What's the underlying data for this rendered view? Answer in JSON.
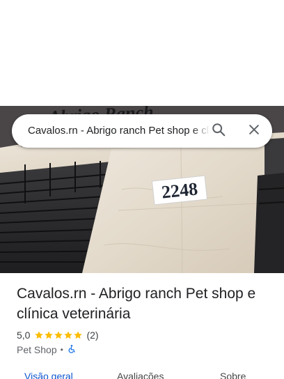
{
  "search": {
    "query": "Cavalos.rn - Abrigo ranch Pet shop e clínica veterinária"
  },
  "photo": {
    "sign_text": "Abrigo Ranch",
    "house_number": "2248"
  },
  "place": {
    "title": "Cavalos.rn - Abrigo ranch Pet shop e clínica veterinária",
    "rating": "5,0",
    "stars": 5,
    "review_count": "(2)",
    "category": "Pet Shop",
    "separator": "•"
  },
  "tabs": [
    {
      "label": "Visão geral",
      "active": true
    },
    {
      "label": "Avaliações",
      "active": false
    },
    {
      "label": "Sobre",
      "active": false
    }
  ],
  "colors": {
    "accent": "#0b57d0",
    "star": "#fbbc04",
    "accessibility": "#1a73e8"
  }
}
